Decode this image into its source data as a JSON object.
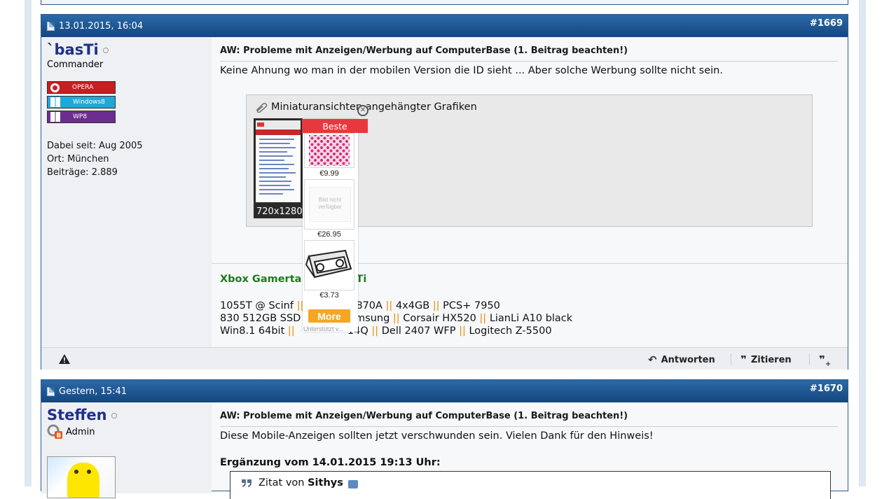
{
  "posts": [
    {
      "date": "13.01.2015, 16:04",
      "number": "#1669",
      "user": {
        "name": "`basTi",
        "title": "Commander",
        "badges": [
          {
            "label": "OPERA",
            "icon": "opera-icon",
            "color": "#c81e1e"
          },
          {
            "label": "Windows8",
            "icon": "windows-icon",
            "color": "#20a8d8"
          },
          {
            "label": "WP8",
            "icon": "windows-phone-icon",
            "color": "#6b2d8f"
          }
        ],
        "joined": "Dabei seit: Aug 2005",
        "location": "Ort: München",
        "posts": "Beiträge: 2.889"
      },
      "title": "AW: Probleme mit Anzeigen/Werbung auf ComputerBase (1. Beitrag beachten!)",
      "text": "Keine Ahnung wo man in der mobilen Version die ID sieht ... Aber solche Werbung sollte nicht sein.",
      "attachments_label": "Miniaturansichten angehängter Grafiken",
      "thumbnail_resolution": "720x1280",
      "signature": {
        "name": "Xbox Gamerta",
        "name_tail": "Ti",
        "lines": [
          [
            "1055T @ Scinf",
            "Gigabyte 870A",
            "4x4GB",
            "PCS+ 7950"
          ],
          [
            "830 512GB SSD",
            "Samsung",
            "Corsair HX520",
            "LianLi A10 black"
          ],
          [
            "Win8.1 64bit",
            "14Q",
            "Dell 2407 WFP",
            "Logitech Z-5500"
          ]
        ],
        "separator": "||"
      },
      "footer": {
        "reply": "Antworten",
        "quote": "Zitieren"
      }
    },
    {
      "date": "Gestern, 15:41",
      "number": "#1670",
      "user": {
        "name": "Steffen",
        "title": "Admin"
      },
      "title": "AW: Probleme mit Anzeigen/Werbung auf ComputerBase (1. Beitrag beachten!)",
      "text": "Diese Mobile-Anzeigen sollten jetzt verschwunden sein. Vielen Dank für den Hinweis!",
      "supplement": "Ergänzung vom 14.01.2015 19:13 Uhr:",
      "quote_prefix": "Zitat von",
      "quote_author": "Sithys"
    }
  ],
  "ad": {
    "header": "Beste",
    "close": "⊗",
    "prices": [
      "€9.99",
      "€26.95",
      "€3.73"
    ],
    "no_image_text": "Bild nicht verfügbar",
    "more": "More",
    "small_text": "Unterstützt v..."
  }
}
